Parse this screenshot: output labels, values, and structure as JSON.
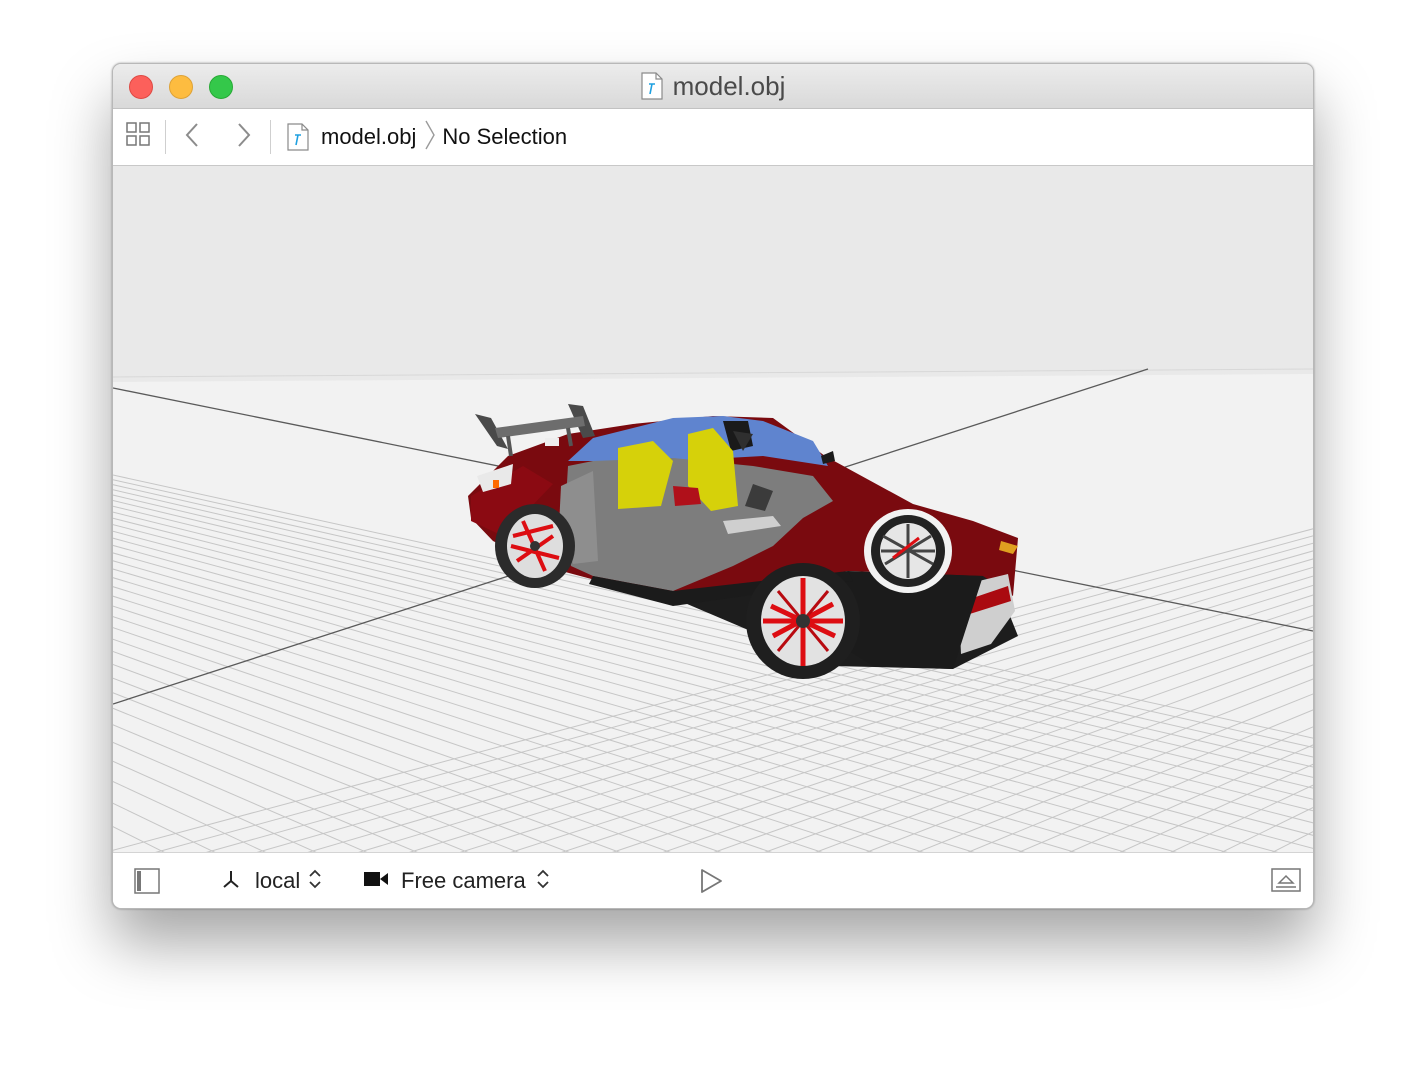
{
  "window": {
    "title": "model.obj"
  },
  "pathbar": {
    "file_name": "model.obj",
    "selection": "No Selection"
  },
  "toolbar": {
    "coordinate_space": "local",
    "camera": "Free camera"
  },
  "scene": {
    "background_color": "#e9e9e9",
    "grid_color": "#c6c6c6",
    "axis_color": "#5a5a5a",
    "car_body_color": "#7a0a0f",
    "wheel_accent_color": "#dd0d12",
    "seat_color": "#d6d10a",
    "glass_color": "#5f84cf"
  },
  "icons": {
    "related_items": "grid-icon",
    "back": "chevron-left-icon",
    "forward": "chevron-right-icon",
    "file": "obj-file-icon",
    "sidebar": "sidebar-toggle-icon",
    "axes": "axes-icon",
    "camera": "video-camera-icon",
    "play": "play-icon",
    "inspector": "inspector-toggle-icon"
  }
}
